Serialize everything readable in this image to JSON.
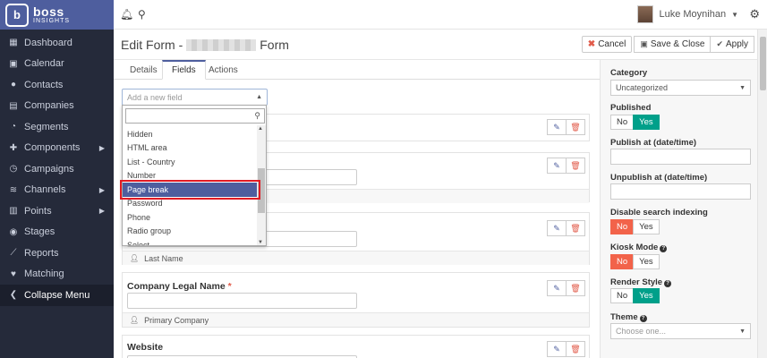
{
  "brand": {
    "logo_letter": "b",
    "name": "boss",
    "tagline": "INSIGHTS"
  },
  "sidebar": {
    "items": [
      {
        "label": "Dashboard",
        "icon": "grid-icon",
        "glyph": "▦",
        "caret": ""
      },
      {
        "label": "Calendar",
        "icon": "calendar-icon",
        "glyph": "▣",
        "caret": ""
      },
      {
        "label": "Contacts",
        "icon": "user-icon",
        "glyph": "●",
        "caret": ""
      },
      {
        "label": "Companies",
        "icon": "building-icon",
        "glyph": "▤",
        "caret": ""
      },
      {
        "label": "Segments",
        "icon": "pie-chart-icon",
        "glyph": "◔",
        "caret": ""
      },
      {
        "label": "Components",
        "icon": "puzzle-icon",
        "glyph": "✚",
        "caret": "▶"
      },
      {
        "label": "Campaigns",
        "icon": "clock-icon",
        "glyph": "◷",
        "caret": ""
      },
      {
        "label": "Channels",
        "icon": "rss-icon",
        "glyph": "≋",
        "caret": "▶"
      },
      {
        "label": "Points",
        "icon": "calculator-icon",
        "glyph": "▥",
        "caret": "▶"
      },
      {
        "label": "Stages",
        "icon": "tachometer-icon",
        "glyph": "◉",
        "caret": ""
      },
      {
        "label": "Reports",
        "icon": "line-chart-icon",
        "glyph": "⟋",
        "caret": ""
      },
      {
        "label": "Matching",
        "icon": "heart-icon",
        "glyph": "♥",
        "caret": ""
      }
    ],
    "collapse_label": "Collapse Menu"
  },
  "topbar": {
    "user_name": "Luke Moynihan"
  },
  "header": {
    "title_prefix": "Edit Form -",
    "title_suffix": "Form",
    "cancel_label": "Cancel",
    "save_close_label": "Save & Close",
    "apply_label": "Apply"
  },
  "tabs": [
    "Details",
    "Fields",
    "Actions"
  ],
  "add_field": {
    "placeholder": "Add a new field"
  },
  "dropdown": {
    "items": [
      "Hidden",
      "HTML area",
      "List - Country",
      "Number",
      "Page break",
      "Password",
      "Phone",
      "Radio group",
      "Select"
    ],
    "selected": "Page break"
  },
  "fields": [
    {
      "label": "",
      "required": false,
      "footer": ""
    },
    {
      "label": "",
      "required": false,
      "footer": ""
    },
    {
      "label": "",
      "required": false,
      "footer": "Last Name"
    },
    {
      "label": "Company Legal Name",
      "required": true,
      "footer": "Primary Company"
    },
    {
      "label": "Website",
      "required": false,
      "footer": ""
    }
  ],
  "properties": {
    "category_label": "Category",
    "category_value": "Uncategorized",
    "published_label": "Published",
    "publish_at_label": "Publish at (date/time)",
    "unpublish_at_label": "Unpublish at (date/time)",
    "disable_indexing_label": "Disable search indexing",
    "kiosk_label": "Kiosk Mode",
    "render_style_label": "Render Style",
    "theme_label": "Theme",
    "theme_placeholder": "Choose one...",
    "no": "No",
    "yes": "Yes"
  },
  "colors": {
    "brand": "#4e5e9e",
    "sidebar": "#252a3a",
    "yes_active": "#00a08a",
    "no_active": "#f2634a",
    "highlight": "#e01b24"
  }
}
